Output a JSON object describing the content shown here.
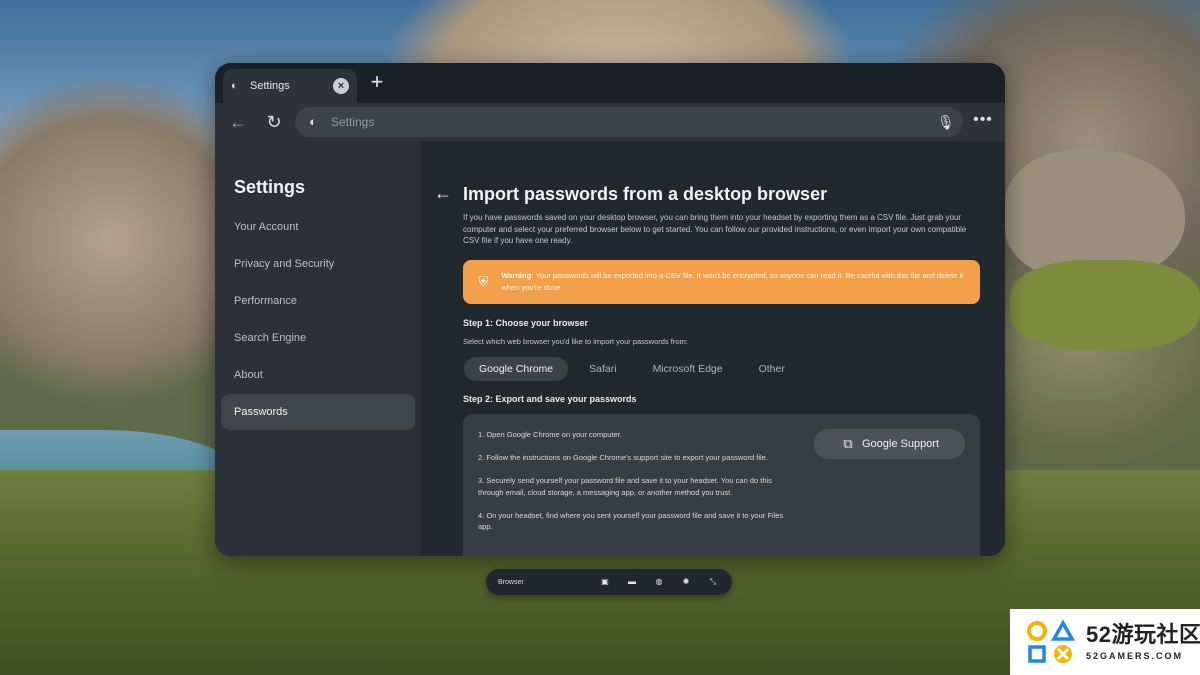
{
  "window": {
    "tab_title": "Settings",
    "tab_icon": "meta-browser-icon",
    "address_bar_text": "Settings"
  },
  "sidebar": {
    "title": "Settings",
    "items": [
      {
        "label": "Your Account"
      },
      {
        "label": "Privacy and Security"
      },
      {
        "label": "Performance"
      },
      {
        "label": "Search Engine"
      },
      {
        "label": "About"
      },
      {
        "label": "Passwords",
        "active": true
      }
    ]
  },
  "main": {
    "title": "Import passwords from a desktop browser",
    "intro": "If you have passwords saved on your desktop browser, you can bring them into your headset by exporting them as a CSV file. Just grab your computer and select your preferred browser below to get started. You can follow our provided instructions, or even import your own compatible CSV file if you have one ready.",
    "warning": {
      "label": "Warning:",
      "text": "Your passwords will be exported into a CSV file. It won't be encrypted, so anyone can read it. Be careful with this file and delete it when you're done.",
      "color": "#f3a04b"
    },
    "step1": {
      "title": "Step 1: Choose your browser",
      "description": "Select which web browser you'd like to import your passwords from:",
      "browsers": [
        "Google Chrome",
        "Safari",
        "Microsoft Edge",
        "Other"
      ],
      "selected": "Google Chrome"
    },
    "step2": {
      "title": "Step 2: Export and save your passwords",
      "instructions": [
        "1. Open Google Chrome on your computer.",
        "2. Follow the instructions on Google Chrome's support site to export your password file.",
        "3. Securely send yourself your password file and save it to your headset. You can do this through email, cloud storage, a messaging app, or another method you trust.",
        "4. On your headset, find where you sent yourself your password file and save it to your Files app."
      ],
      "support_button": "Google Support"
    }
  },
  "dock": {
    "label": "Browser"
  },
  "watermark": {
    "title": "52游玩社区",
    "subtitle": "52GAMERS.COM"
  }
}
